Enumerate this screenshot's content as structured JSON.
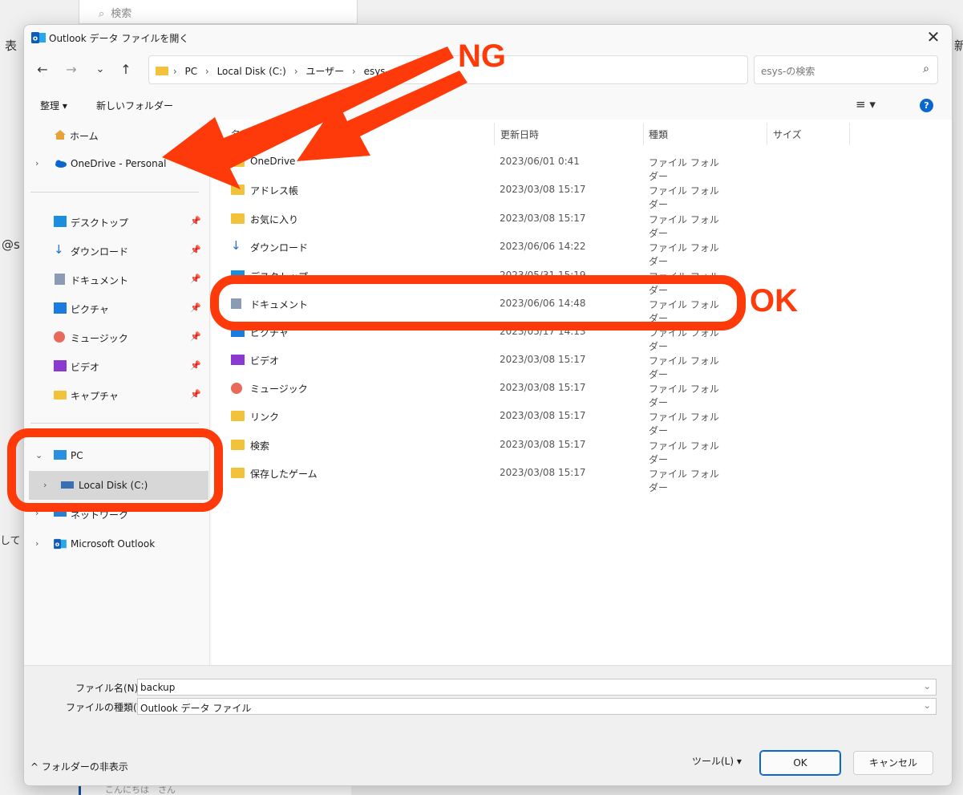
{
  "background": {
    "search_icon": "⌕",
    "search_text": "検索",
    "frag_left_top": "表",
    "frag_right_top": "新",
    "frag_left_mid": "@s",
    "frag_left_low": "して",
    "bottom_text": "こんにちは　さん"
  },
  "dialog": {
    "title": "Outlook データ ファイルを開く",
    "close": "✕",
    "nav": {
      "back": "←",
      "forward": "→",
      "recent": "⌄",
      "up": "↑"
    },
    "address": {
      "crumbs": [
        "PC",
        "Local Disk (C:)",
        "ユーザー",
        "esys-"
      ],
      "separator": "›",
      "dropdown": "⌄",
      "refresh": "↻"
    },
    "search": {
      "placeholder": "esys-の検索",
      "icon": "⌕"
    },
    "toolbar": {
      "organize": "整理 ▾",
      "new_folder": "新しいフォルダー",
      "view": "≡ ▾",
      "help": "?"
    }
  },
  "sidebar": {
    "home": "ホーム",
    "onedrive": "OneDrive - Personal",
    "quick": [
      {
        "label": "デスクトップ",
        "pin": "📌"
      },
      {
        "label": "ダウンロード",
        "pin": "📌"
      },
      {
        "label": "ドキュメント",
        "pin": "📌"
      },
      {
        "label": "ピクチャ",
        "pin": "📌"
      },
      {
        "label": "ミュージック",
        "pin": "📌"
      },
      {
        "label": "ビデオ",
        "pin": "📌"
      },
      {
        "label": "キャプチャ",
        "pin": "📌"
      }
    ],
    "pc": "PC",
    "local_disk": "Local Disk (C:)",
    "network": "ネットワーク",
    "outlook": "Microsoft Outlook",
    "chevron_right": "›",
    "chevron_down": "⌄"
  },
  "columns": {
    "name": "名前",
    "date": "更新日時",
    "type": "種類",
    "size": "サイズ"
  },
  "files": [
    {
      "name": "OneDrive",
      "date": "2023/06/01 0:41",
      "type": "ファイル フォルダー"
    },
    {
      "name": "アドレス帳",
      "date": "2023/03/08 15:17",
      "type": "ファイル フォルダー"
    },
    {
      "name": "お気に入り",
      "date": "2023/03/08 15:17",
      "type": "ファイル フォルダー"
    },
    {
      "name": "ダウンロード",
      "date": "2023/06/06 14:22",
      "type": "ファイル フォルダー"
    },
    {
      "name": "デスクトップ",
      "date": "2023/05/31 15:19",
      "type": "ファイル フォルダー"
    },
    {
      "name": "ドキュメント",
      "date": "2023/06/06 14:48",
      "type": "ファイル フォルダー"
    },
    {
      "name": "ピクチャ",
      "date": "2023/05/17 14:13",
      "type": "ファイル フォルダー"
    },
    {
      "name": "ビデオ",
      "date": "2023/03/08 15:17",
      "type": "ファイル フォルダー"
    },
    {
      "name": "ミュージック",
      "date": "2023/03/08 15:17",
      "type": "ファイル フォルダー"
    },
    {
      "name": "リンク",
      "date": "2023/03/08 15:17",
      "type": "ファイル フォルダー"
    },
    {
      "name": "検索",
      "date": "2023/03/08 15:17",
      "type": "ファイル フォルダー"
    },
    {
      "name": "保存したゲーム",
      "date": "2023/03/08 15:17",
      "type": "ファイル フォルダー"
    }
  ],
  "bottom": {
    "filename_label": "ファイル名(N):",
    "filename_value": "backup",
    "filetype_label": "ファイルの種類(T):",
    "filetype_value": "Outlook データ ファイル",
    "dropdown": "⌄",
    "hide_folders": "^ フォルダーの非表示",
    "tools": "ツール(L) ▾",
    "ok": "OK",
    "cancel": "キャンセル"
  },
  "annotations": {
    "ng": "NG",
    "ok": "OK",
    "color": "#ff3a0a"
  }
}
